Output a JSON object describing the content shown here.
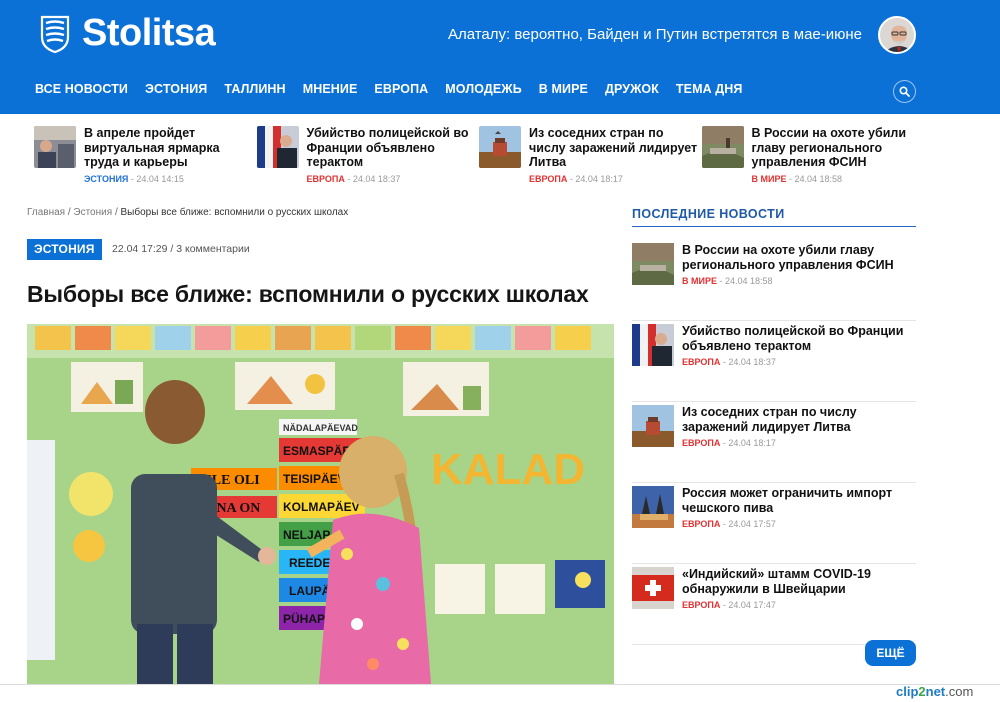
{
  "brand": {
    "name": "Stolitsa"
  },
  "header": {
    "top_headline": "Алаталу: вероятно, Байден и Путин встретятся в мае-июне"
  },
  "nav": {
    "items": [
      "ВСЕ НОВОСТИ",
      "ЭСТОНИЯ",
      "ТАЛЛИНН",
      "МНЕНИЕ",
      "ЕВРОПА",
      "МОЛОДЕЖЬ",
      "В МИРЕ",
      "ДРУЖОК",
      "ТЕМА ДНЯ"
    ]
  },
  "strip": [
    {
      "title": "В апреле пройдет виртуальная ярмарка труда и карьеры",
      "category": "ЭСТОНИЯ",
      "date": " - 24.04 14:15"
    },
    {
      "title": "Убийство полицейской во Франции объявлено терактом",
      "category": "ЕВРОПА",
      "date": " - 24.04 18:37"
    },
    {
      "title": "Из соседних стран по числу заражений лидирует Литва",
      "category": "ЕВРОПА",
      "date": " - 24.04 18:17"
    },
    {
      "title": "В России на охоте убили главу регионального управления ФСИН",
      "category": "В МИРЕ",
      "date": " - 24.04 18:58"
    }
  ],
  "breadcrumb": {
    "home": "Главная",
    "section": "Эстония",
    "current": "Выборы все ближе: вспомнили о русских школах"
  },
  "article": {
    "tag": "ЭСТОНИЯ",
    "datetime": "22.04 17:29",
    "comments": "3 комментарии",
    "title": "Выборы все ближе: вспомнили о русских школах",
    "image_words": [
      "NÄDALAPÄEVAD",
      "ESMASPÄEV",
      "TEISIPÄEV",
      "KOLMAPÄEV",
      "NELJAPÄEV",
      "REEDE",
      "LAUPÄEV",
      "PÜHAPÄEV",
      "EILE OLI",
      "TÄNA ON",
      "KALAD"
    ]
  },
  "sidebar": {
    "title": "ПОСЛЕДНИЕ НОВОСТИ",
    "items": [
      {
        "title": "В России на охоте убили главу регионального управления ФСИН",
        "category": "В МИРЕ",
        "date": " - 24.04 18:58"
      },
      {
        "title": "Убийство полицейской во Франции объявлено терактом",
        "category": "ЕВРОПА",
        "date": " - 24.04 18:37"
      },
      {
        "title": "Из соседних стран по числу заражений лидирует Литва",
        "category": "ЕВРОПА",
        "date": " - 24.04 18:17"
      },
      {
        "title": "Россия может ограничить импорт чешского пива",
        "category": "ЕВРОПА",
        "date": " - 24.04 17:57"
      },
      {
        "title": "«Индийский» штамм COVID-19 обнаружили в Швейцарии",
        "category": "ЕВРОПА",
        "date": " - 24.04 17:47"
      }
    ],
    "more_label": "ЕЩЁ"
  },
  "watermark": {
    "a": "clip",
    "b": "2",
    "c": "net",
    "d": ".com"
  },
  "colors": {
    "brand_blue": "#0b71d6",
    "category_red": "#e23232",
    "category_blue": "#1f72d6"
  }
}
